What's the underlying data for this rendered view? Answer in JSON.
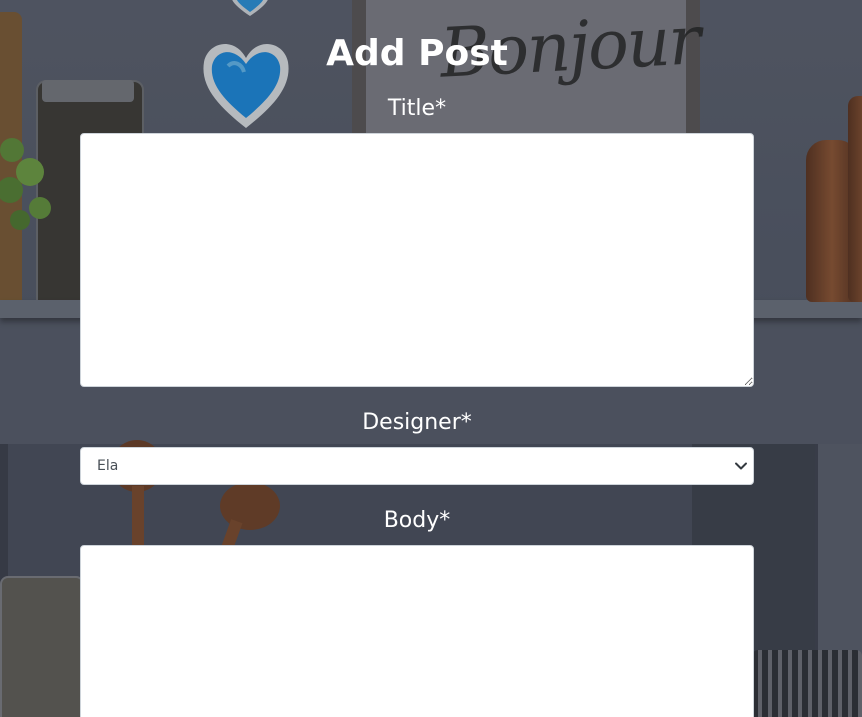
{
  "form": {
    "heading": "Add Post",
    "title_label": "Title*",
    "title_value": "",
    "designer_label": "Designer*",
    "designer_selected": "Ela",
    "body_label": "Body*",
    "body_value": ""
  },
  "icons": {
    "select_arrow": "chevron-down-icon"
  },
  "colors": {
    "label_text": "#ffffff",
    "input_background": "#ffffff",
    "input_border": "#ced4da",
    "select_text": "#495057"
  }
}
